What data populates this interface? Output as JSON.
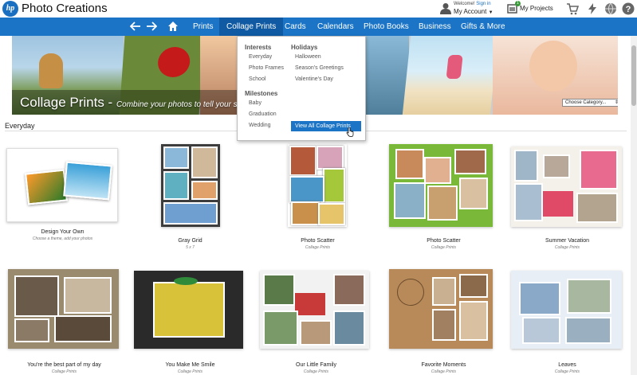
{
  "header": {
    "brand": "Photo Creations",
    "logo_text": "hp",
    "welcome_prefix": "Welcome!",
    "sign_in": "Sign in",
    "account": "My Account",
    "account_caret": "▼",
    "projects": "My Projects",
    "projects_count": "1",
    "icons": [
      "user-icon",
      "projects-icon",
      "cart-icon",
      "lightning-icon",
      "globe-icon",
      "help-icon"
    ]
  },
  "nav": {
    "back_icon": "arrow-left-icon",
    "forward_icon": "arrow-right-icon",
    "home_icon": "home-icon",
    "items": [
      "Prints",
      "Collage Prints",
      "Cards",
      "Calendars",
      "Photo Books",
      "Business",
      "Gifts & More"
    ],
    "active": "Collage Prints"
  },
  "hero": {
    "title": "Collage Prints - ",
    "subtitle": "Combine your photos to tell your s",
    "choose_label": "Choose Category...",
    "choose_caret": "⇕"
  },
  "dropdown": {
    "interests_head": "Interests",
    "interests": [
      "Everyday",
      "Photo Frames",
      "School"
    ],
    "holidays_head": "Holidays",
    "holidays": [
      "Halloween",
      "Season's Greetings",
      "Valentine's Day"
    ],
    "milestones_head": "Milestones",
    "milestones": [
      "Baby",
      "Graduation",
      "Wedding"
    ],
    "view_all": "View All Collage Prints"
  },
  "section": {
    "title": "Everyday"
  },
  "cards": [
    {
      "name": "Design Your Own",
      "meta": "Choose a theme, add your photos"
    },
    {
      "name": "Gray Grid",
      "meta": "5 x 7"
    },
    {
      "name": "Photo Scatter",
      "meta": "Collage Prints"
    },
    {
      "name": "Photo Scatter",
      "meta": "Collage Prints"
    },
    {
      "name": "Summer Vacation",
      "meta": "Collage Prints"
    },
    {
      "name": "You're the best part of my day",
      "meta": "Collage Prints"
    },
    {
      "name": "You Make Me Smile",
      "meta": "Collage Prints"
    },
    {
      "name": "Our Little Family",
      "meta": "Collage Prints"
    },
    {
      "name": "Favorite Moments",
      "meta": "Collage Prints"
    },
    {
      "name": "Leaves",
      "meta": "Collage Prints"
    }
  ],
  "colors": {
    "nav_blue": "#1b74c6",
    "nav_active": "#0f5aa3"
  }
}
